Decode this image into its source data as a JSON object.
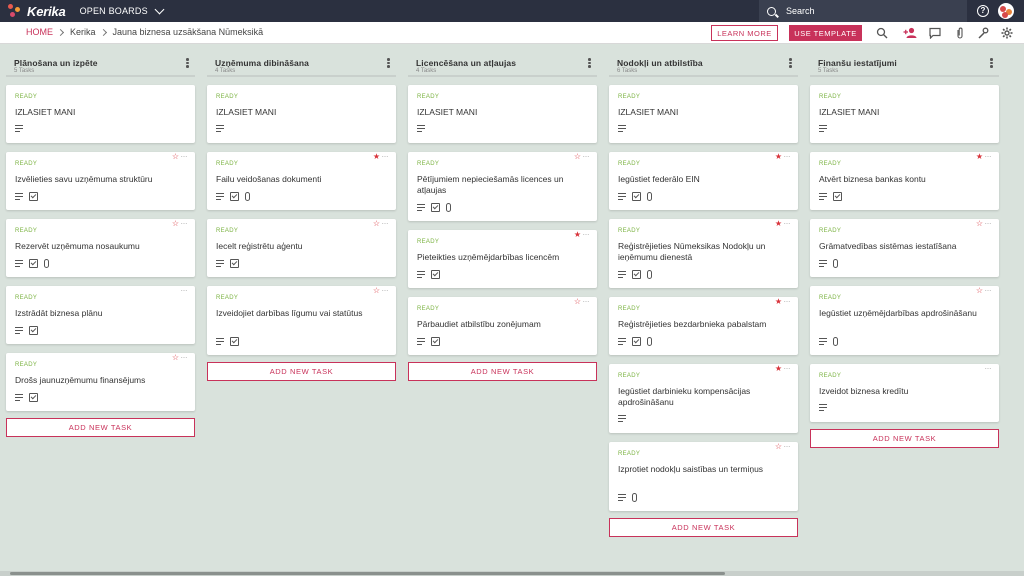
{
  "app": {
    "logo_text": "Kerika",
    "open_boards": "OPEN BOARDS",
    "search_label": "Search",
    "help_glyph": "?"
  },
  "breadcrumb": [
    "HOME",
    "Kerika",
    "Jauna biznesa uzsākšana Nūmeksikā"
  ],
  "actions": {
    "learn_more": "LEARN MORE",
    "use_template": "USE TEMPLATE"
  },
  "header_icons": [
    "search-icon",
    "add-person-icon",
    "chat-icon",
    "attachment-icon",
    "tag-icon",
    "gear-icon"
  ],
  "colors": {
    "accent": "#c8325a",
    "topbar": "#2b3040",
    "ready": "#7bb342",
    "star": "#d8323a"
  },
  "columns": [
    {
      "title": "Plānošana un izpēte",
      "count": "5 Tasks",
      "add_label": "ADD NEW TASK",
      "cards": [
        {
          "status": "READY",
          "title": "IZLASIET MANI",
          "icons": [
            "desc"
          ],
          "star": "",
          "more": false
        },
        {
          "status": "READY",
          "title": "Izvēlieties savu uzņēmuma struktūru",
          "icons": [
            "desc",
            "check"
          ],
          "star": "outline",
          "more": true
        },
        {
          "status": "READY",
          "title": "Rezervēt uzņēmuma nosaukumu",
          "icons": [
            "desc",
            "check",
            "clip"
          ],
          "star": "outline",
          "more": true
        },
        {
          "status": "READY",
          "title": "Izstrādāt biznesa plānu",
          "icons": [
            "desc",
            "check"
          ],
          "star": "",
          "more": true
        },
        {
          "status": "READY",
          "title": "Drošs jaunuzņēmumu finansējums",
          "icons": [
            "desc",
            "check"
          ],
          "star": "outline",
          "more": true
        }
      ]
    },
    {
      "title": "Uzņēmuma dibināšana",
      "count": "4 Tasks",
      "add_label": "ADD NEW TASK",
      "cards": [
        {
          "status": "READY",
          "title": "IZLASIET MANI",
          "icons": [
            "desc"
          ],
          "star": "",
          "more": false
        },
        {
          "status": "READY",
          "title": "Failu veidošanas dokumenti",
          "icons": [
            "desc",
            "check",
            "clip"
          ],
          "star": "filled",
          "more": true
        },
        {
          "status": "READY",
          "title": "Iecelt reģistrētu aģentu",
          "icons": [
            "desc",
            "check"
          ],
          "star": "outline",
          "more": true
        },
        {
          "status": "READY",
          "title": "Izveidojiet darbības līgumu vai statūtus",
          "icons": [
            "desc",
            "check"
          ],
          "star": "outline",
          "more": true
        }
      ]
    },
    {
      "title": "Licencēšana un atļaujas",
      "count": "4 Tasks",
      "add_label": "ADD NEW TASK",
      "cards": [
        {
          "status": "READY",
          "title": "IZLASIET MANI",
          "icons": [
            "desc"
          ],
          "star": "",
          "more": false
        },
        {
          "status": "READY",
          "title": "Pētījumiem nepieciešamās licences un atļaujas",
          "icons": [
            "desc",
            "check",
            "clip"
          ],
          "star": "outline",
          "more": true
        },
        {
          "status": "READY",
          "title": "Pieteikties uzņēmējdarbības licencēm",
          "icons": [
            "desc",
            "check"
          ],
          "star": "filled",
          "more": true
        },
        {
          "status": "READY",
          "title": "Pārbaudiet atbilstību zonējumam",
          "icons": [
            "desc",
            "check"
          ],
          "star": "outline",
          "more": true
        }
      ]
    },
    {
      "title": "Nodokļi un atbilstība",
      "count": "6 Tasks",
      "add_label": "ADD NEW TASK",
      "cards": [
        {
          "status": "READY",
          "title": "IZLASIET MANI",
          "icons": [
            "desc"
          ],
          "star": "",
          "more": false
        },
        {
          "status": "READY",
          "title": "Iegūstiet federālo EIN",
          "icons": [
            "desc",
            "check",
            "clip"
          ],
          "star": "filled",
          "more": true
        },
        {
          "status": "READY",
          "title": "Reģistrējieties Nūmeksikas Nodokļu un ieņēmumu dienestā",
          "icons": [
            "desc",
            "check",
            "clip"
          ],
          "star": "filled",
          "more": true
        },
        {
          "status": "READY",
          "title": "Reģistrējieties bezdarbnieka pabalstam",
          "icons": [
            "desc",
            "check",
            "clip"
          ],
          "star": "filled",
          "more": true
        },
        {
          "status": "READY",
          "title": "Iegūstiet darbinieku kompensācijas apdrošināšanu",
          "icons": [
            "desc"
          ],
          "star": "filled",
          "more": true
        },
        {
          "status": "READY",
          "title": "Izprotiet nodokļu saistības un termiņus",
          "icons": [
            "desc",
            "clip"
          ],
          "star": "outline",
          "more": true
        }
      ]
    },
    {
      "title": "Finanšu iestatījumi",
      "count": "5 Tasks",
      "add_label": "ADD NEW TASK",
      "cards": [
        {
          "status": "READY",
          "title": "IZLASIET MANI",
          "icons": [
            "desc"
          ],
          "star": "",
          "more": false
        },
        {
          "status": "READY",
          "title": "Atvērt biznesa bankas kontu",
          "icons": [
            "desc",
            "check"
          ],
          "star": "filled",
          "more": true
        },
        {
          "status": "READY",
          "title": "Grāmatvedības sistēmas iestatīšana",
          "icons": [
            "desc",
            "clip"
          ],
          "star": "outline",
          "more": true
        },
        {
          "status": "READY",
          "title": "Iegūstiet uzņēmējdarbības apdrošināšanu",
          "icons": [
            "desc",
            "clip"
          ],
          "star": "outline",
          "more": true
        },
        {
          "status": "READY",
          "title": "Izveidot biznesa kredītu",
          "icons": [
            "desc"
          ],
          "star": "",
          "more": true
        }
      ]
    }
  ]
}
